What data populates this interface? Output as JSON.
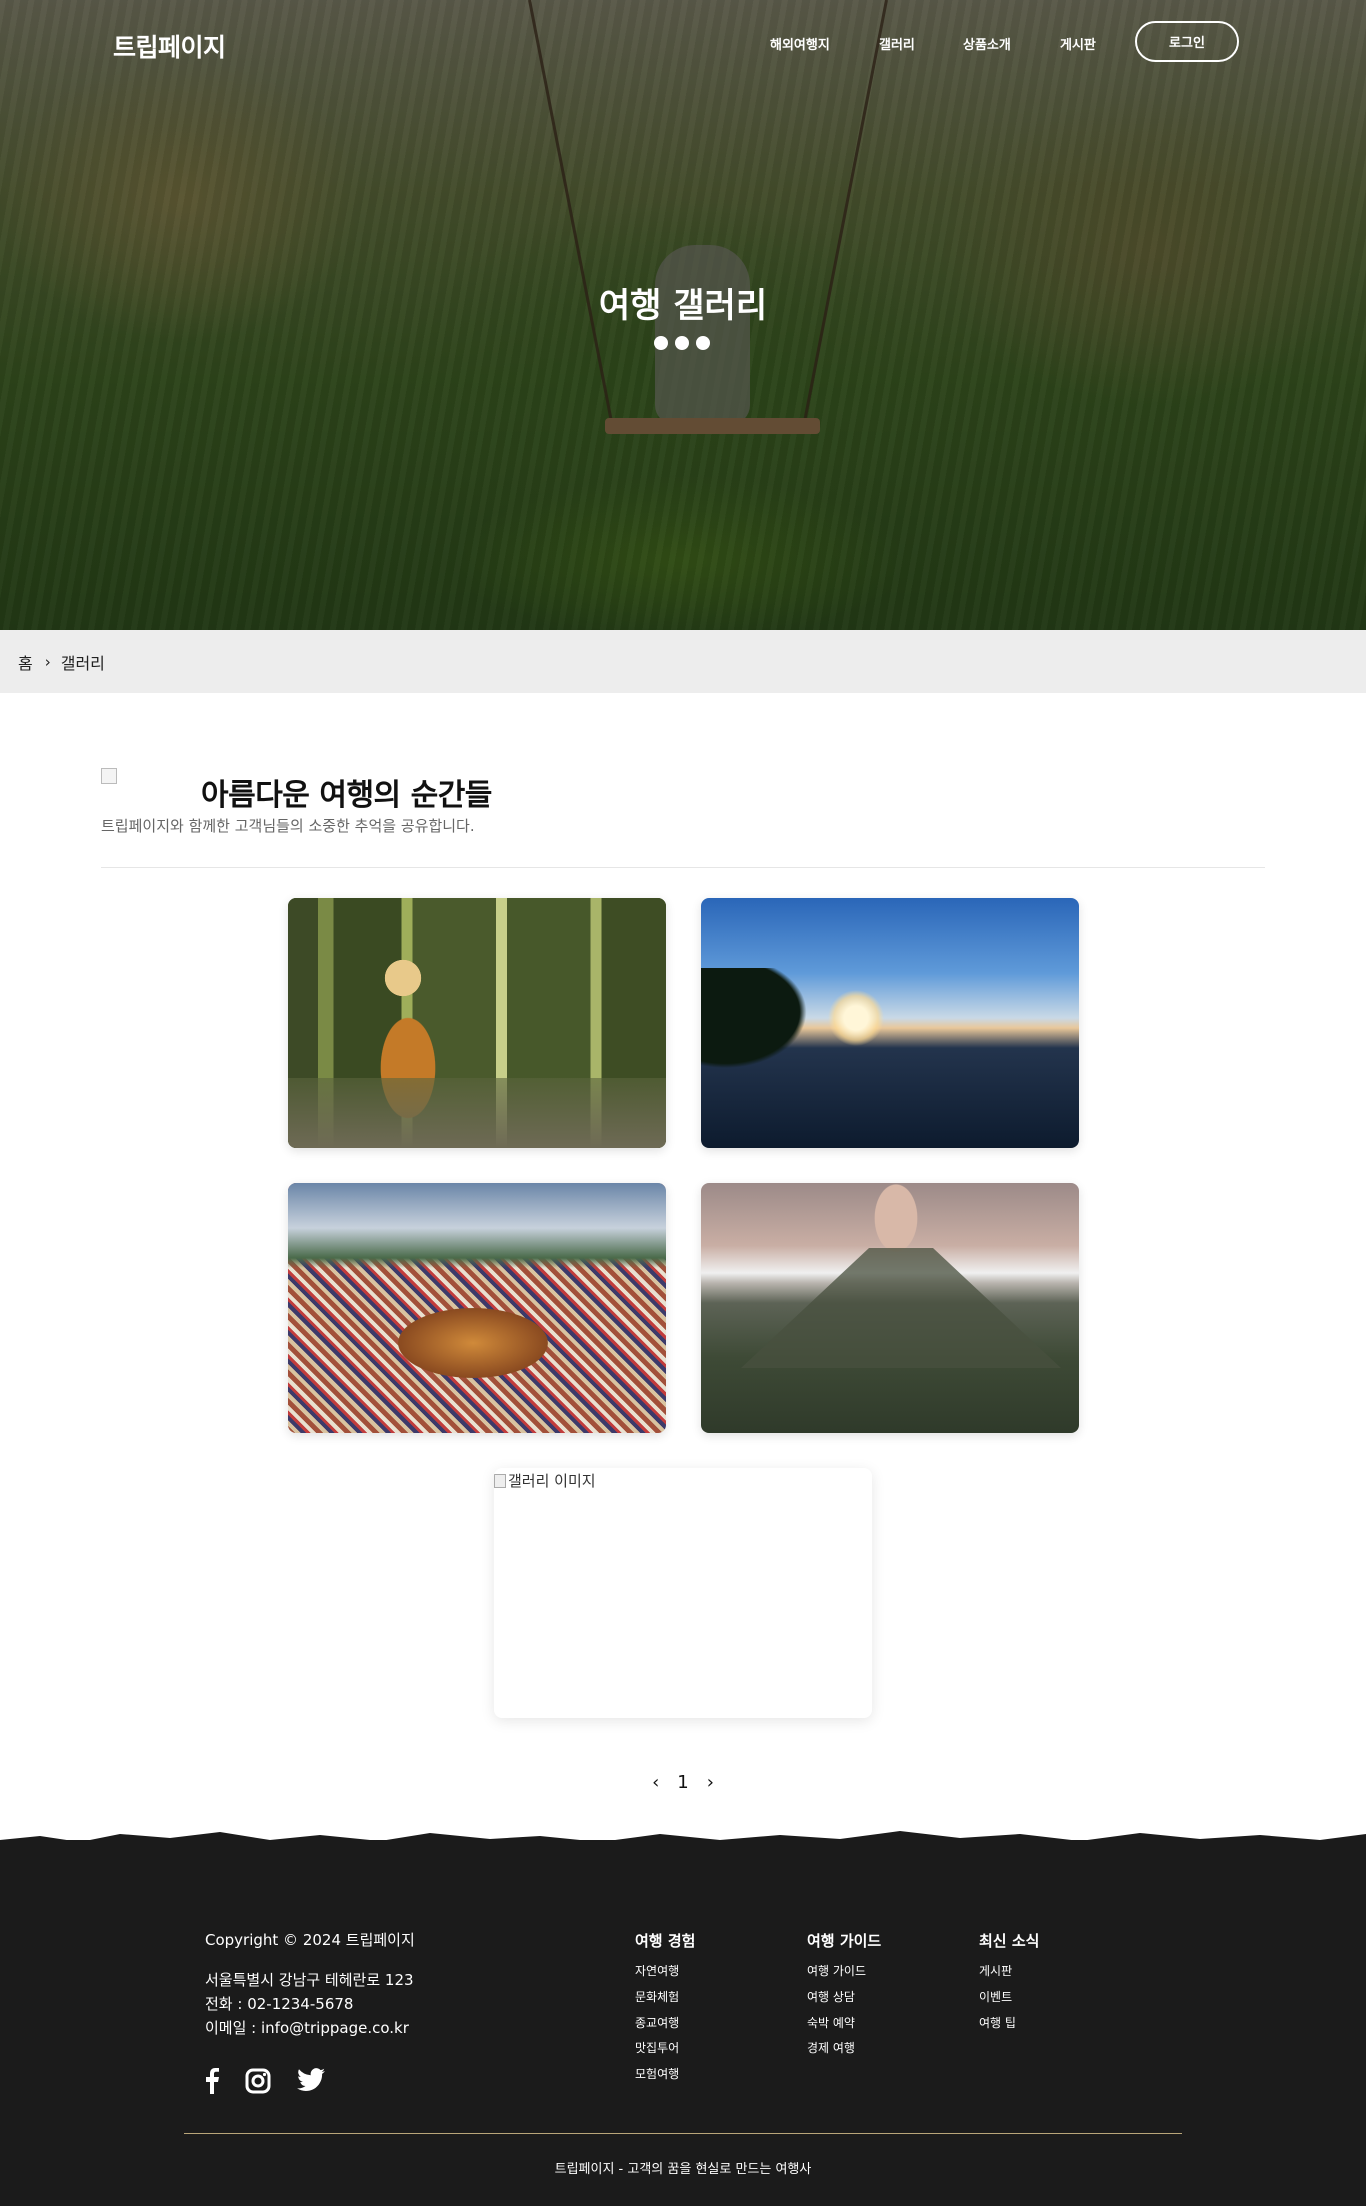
{
  "header": {
    "logo": "트립페이지",
    "nav": [
      "해외여행지",
      "갤러리",
      "상품소개",
      "게시판"
    ],
    "login": "로그인"
  },
  "hero": {
    "title": "여행 갤러리"
  },
  "breadcrumb": {
    "home": "홈",
    "separator": "›",
    "current": "갤러리"
  },
  "section": {
    "title": "아름다운 여행의 순간들",
    "subtitle": "트립페이지와 함께한 고객님들의 소중한 추억을 공유합니다."
  },
  "gallery": {
    "broken_alt": "갤러리 이미지"
  },
  "pagination": {
    "prev": "‹",
    "current": "1",
    "next": "›"
  },
  "footer": {
    "copyright": "Copyright © 2024 트립페이지",
    "address": "서울특별시 강남구 테헤란로 123",
    "phone": "전화 : 02-1234-5678",
    "email": "이메일 : info@trippage.co.kr",
    "columns": [
      {
        "title": "여행 경험",
        "links": [
          "자연여행",
          "문화체험",
          "종교여행",
          "맛집투어",
          "모험여행"
        ]
      },
      {
        "title": "여행 가이드",
        "links": [
          "여행 가이드",
          "여행 상담",
          "숙박 예약",
          "경제 여행"
        ]
      },
      {
        "title": "최신 소식",
        "links": [
          "게시판",
          "이벤트",
          "여행 팁"
        ]
      }
    ],
    "tagline": "트립페이지 - 고객의 꿈을 현실로 만드는 여행사"
  },
  "colors": {
    "footer_bg": "#1b1b1b",
    "footer_rule": "#b9a679",
    "breadcrumb_bg": "#ededed"
  }
}
